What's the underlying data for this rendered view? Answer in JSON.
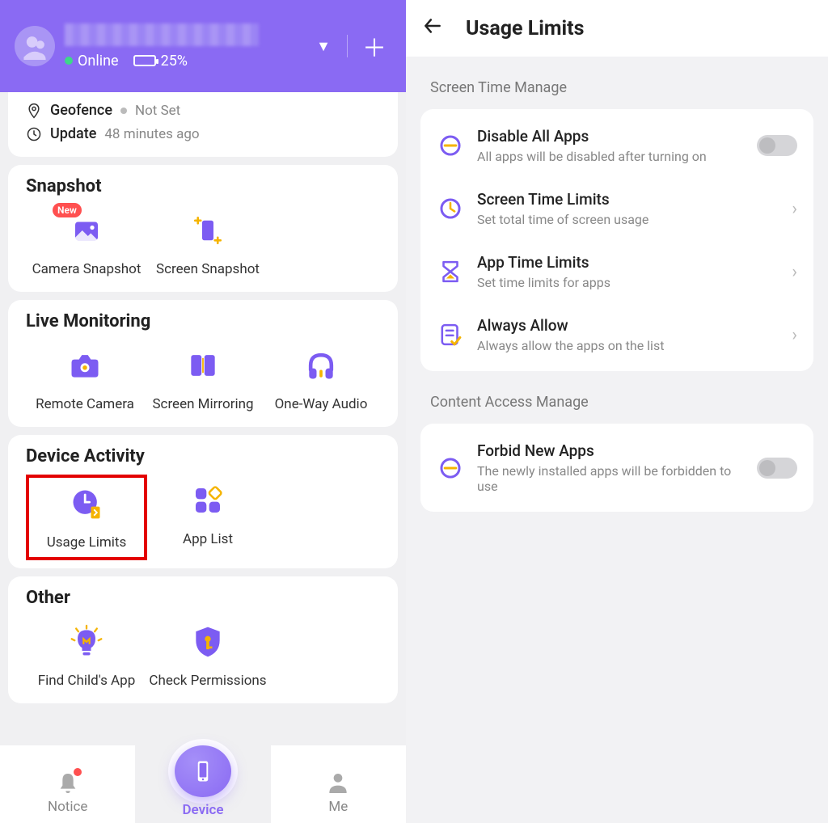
{
  "left": {
    "header": {
      "status_online": "Online",
      "battery_pct": "25%"
    },
    "info": {
      "geofence_label": "Geofence",
      "geofence_value": "Not Set",
      "update_label": "Update",
      "update_value": "48 minutes ago"
    },
    "sections": {
      "snapshot": {
        "title": "Snapshot",
        "camera": "Camera Snapshot",
        "screen": "Screen Snapshot",
        "new_badge": "New"
      },
      "live": {
        "title": "Live Monitoring",
        "remote_camera": "Remote Camera",
        "screen_mirroring": "Screen Mirroring",
        "one_way_audio": "One-Way Audio"
      },
      "activity": {
        "title": "Device Activity",
        "usage_limits": "Usage Limits",
        "app_list": "App List"
      },
      "other": {
        "title": "Other",
        "find_child": "Find Child's App",
        "check_permissions": "Check Permissions"
      }
    },
    "nav": {
      "notice": "Notice",
      "device": "Device",
      "me": "Me"
    }
  },
  "right": {
    "title": "Usage Limits",
    "group1": "Screen Time Manage",
    "disable_all": {
      "title": "Disable All Apps",
      "sub": "All apps will be disabled after turning on"
    },
    "screen_time": {
      "title": "Screen Time Limits",
      "sub": "Set total time of screen usage"
    },
    "app_time": {
      "title": "App Time Limits",
      "sub": "Set time limits for apps"
    },
    "always_allow": {
      "title": "Always Allow",
      "sub": "Always allow the apps on the list"
    },
    "group2": "Content Access Manage",
    "forbid_new": {
      "title": "Forbid New Apps",
      "sub": "The newly installed apps will be forbidden to use"
    }
  }
}
